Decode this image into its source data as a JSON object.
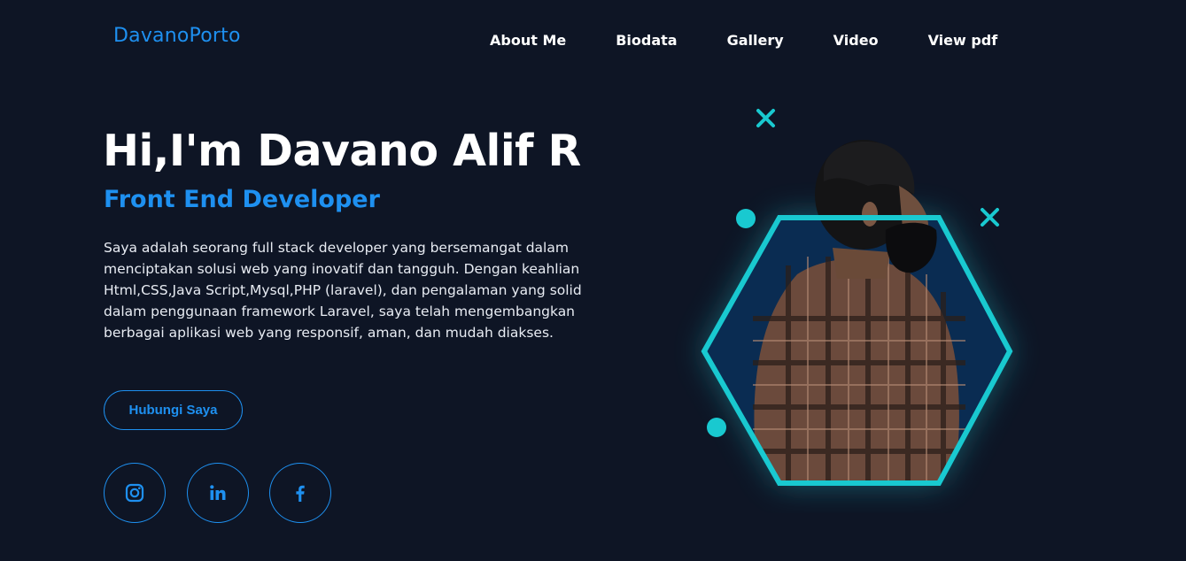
{
  "brand": {
    "logo": "DavanoPorto"
  },
  "nav": {
    "items": [
      {
        "label": "About Me"
      },
      {
        "label": "Biodata"
      },
      {
        "label": "Gallery"
      },
      {
        "label": "Video"
      },
      {
        "label": "View pdf"
      }
    ]
  },
  "hero": {
    "title": "Hi,I'm Davano Alif R",
    "subtitle": "Front End Developer",
    "description": "Saya adalah seorang full stack developer yang bersemangat dalam menciptakan solusi web yang inovatif dan tangguh. Dengan keahlian Html,CSS,Java Script,Mysql,PHP (laravel), dan pengalaman yang solid dalam penggunaan framework Laravel, saya telah mengembangkan berbagai aplikasi web yang responsif, aman, dan mudah diakses.",
    "cta_label": "Hubungi Saya"
  },
  "social": [
    {
      "icon": "instagram-icon"
    },
    {
      "icon": "linkedin-icon"
    },
    {
      "icon": "facebook-icon"
    }
  ],
  "colors": {
    "background": "#0e1525",
    "accent_blue": "#1e90f0",
    "accent_cyan": "#19c9d0",
    "hexagon_fill": "#0a2c52"
  }
}
